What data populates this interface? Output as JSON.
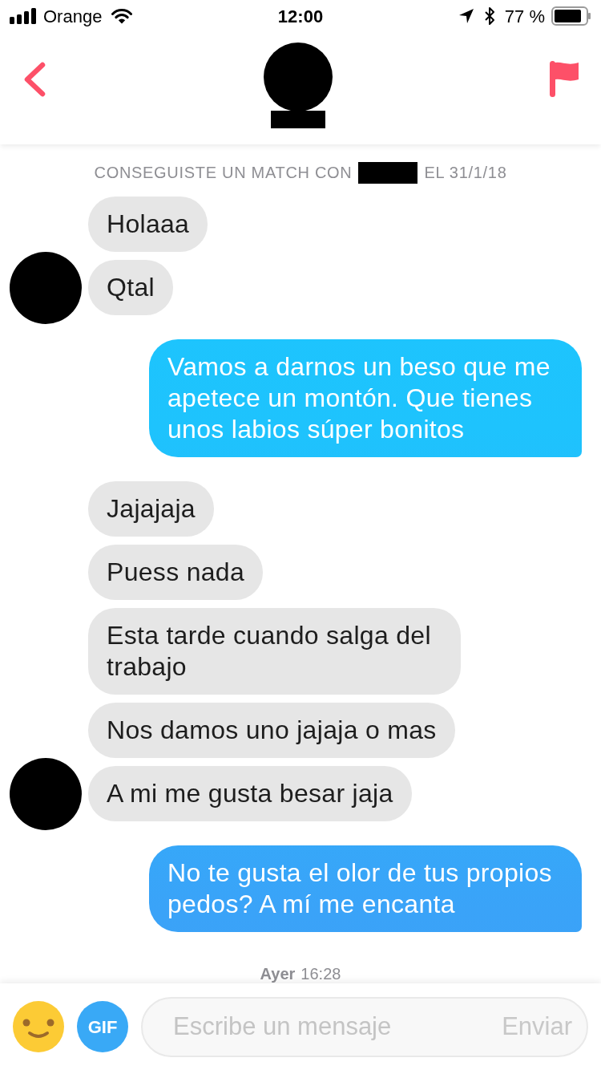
{
  "status_bar": {
    "carrier": "Orange",
    "time": "12:00",
    "battery": "77 %"
  },
  "match_notice": {
    "before": "CONSEGUISTE UN MATCH CON",
    "after": "EL 31/1/18"
  },
  "message_groups": [
    {
      "kind": "received",
      "messages": [
        "Holaaa",
        "Qtal"
      ]
    },
    {
      "kind": "sent",
      "messages": [
        "Vamos a darnos un beso que me apetece un montón. Que tienes unos labios súper bonitos"
      ]
    },
    {
      "kind": "received",
      "messages": [
        "Jajajaja",
        "Puess nada",
        "Esta tarde cuando salga del trabajo",
        "Nos damos uno jajaja o mas",
        "A mi me gusta besar jaja"
      ]
    },
    {
      "kind": "sent",
      "messages": [
        "No te gusta el olor de tus propios pedos? A mí me encanta"
      ]
    }
  ],
  "timestamp": {
    "day": "Ayer",
    "time": "16:28"
  },
  "composer": {
    "gif_label": "GIF",
    "placeholder": "Escribe un mensaje",
    "send_label": "Enviar"
  }
}
